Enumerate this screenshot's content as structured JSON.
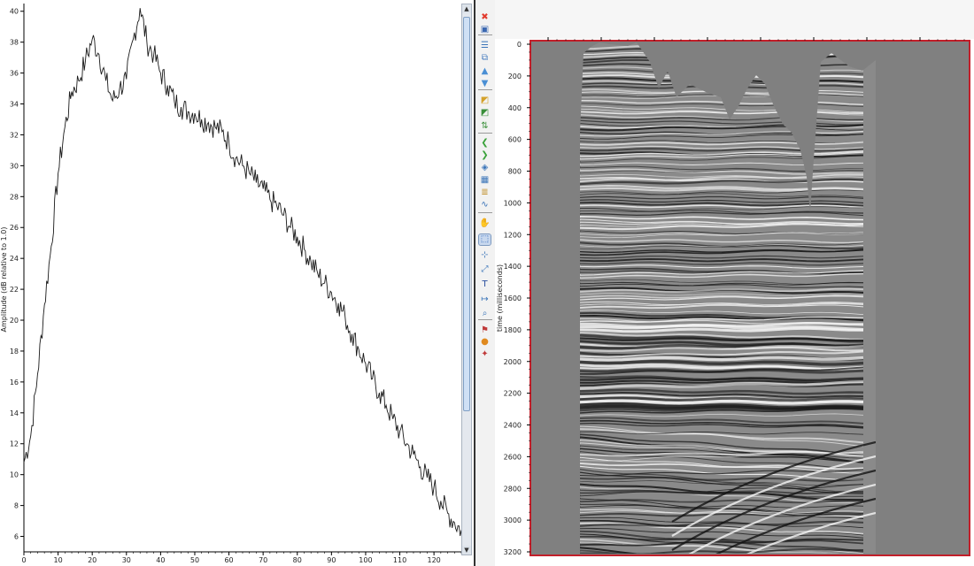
{
  "spectrum_plot": {
    "ylabel": "Amplitude (dB relative to 1.0)",
    "chart_data": {
      "type": "line",
      "xlabel": "",
      "ylabel": "Amplitude (dB relative to 1.0)",
      "xlim": [
        0,
        128
      ],
      "ylim": [
        5,
        40.5
      ],
      "x_ticks": [
        0,
        10,
        20,
        30,
        40,
        50,
        60,
        70,
        80,
        90,
        100,
        110,
        120
      ],
      "y_ticks": [
        6,
        8,
        10,
        12,
        14,
        16,
        18,
        20,
        22,
        24,
        26,
        28,
        30,
        32,
        34,
        36,
        38,
        40
      ],
      "series": [
        {
          "x": [
            0,
            2,
            4,
            6,
            8,
            10,
            12,
            14,
            16,
            18,
            20,
            22,
            24,
            26,
            28,
            30,
            32,
            34,
            36,
            38,
            40,
            42,
            44,
            46,
            48,
            50,
            52,
            54,
            56,
            58,
            60,
            62,
            64,
            66,
            68,
            70,
            72,
            74,
            76,
            78,
            80,
            82,
            84,
            86,
            88,
            90,
            92,
            94,
            96,
            98,
            100,
            102,
            104,
            106,
            108,
            110,
            112,
            114,
            116,
            118,
            120,
            122,
            124,
            126,
            128
          ],
          "values": [
            10.8,
            12.5,
            16.5,
            21,
            24.8,
            29.5,
            32.5,
            34.8,
            35.5,
            36.8,
            38.2,
            37.2,
            35.5,
            34.2,
            35,
            35.6,
            38.2,
            40.2,
            38,
            37.2,
            36,
            35.2,
            34.2,
            33.8,
            33.5,
            33.4,
            33,
            32.8,
            32.5,
            32.2,
            31.5,
            30.5,
            30,
            29.5,
            28.9,
            28.5,
            27.8,
            27.4,
            26.8,
            26,
            25.4,
            24.6,
            23.8,
            23,
            22.4,
            21.8,
            21.1,
            20.2,
            19.1,
            18.1,
            17.2,
            16.2,
            15.3,
            14.5,
            13.6,
            12.8,
            12,
            11.3,
            10.5,
            9.8,
            9.2,
            8.3,
            7.5,
            6.9,
            6.4
          ]
        }
      ]
    }
  },
  "toolbar": {
    "tools": [
      {
        "name": "close-tool-icon",
        "glyph": "✖",
        "color": "#e23b2e"
      },
      {
        "name": "print-tool-icon",
        "glyph": "▣",
        "color": "#3a67b0"
      },
      {
        "name": "list-tool-icon",
        "glyph": "☰",
        "color": "#3a74b8"
      },
      {
        "name": "copy-tool-icon",
        "glyph": "⧉",
        "color": "#4a7fc0"
      },
      {
        "name": "arrow-up-tool-icon",
        "glyph": "▲",
        "color": "#4a8fd4"
      },
      {
        "name": "arrow-down-tool-icon",
        "glyph": "▼",
        "color": "#4a8fd4"
      },
      {
        "name": "page-edit-tool-icon",
        "glyph": "◩",
        "color": "#d4a12a"
      },
      {
        "name": "page-check-tool-icon",
        "glyph": "◩",
        "color": "#3a8f3a"
      },
      {
        "name": "exchange-tool-icon",
        "glyph": "⇅",
        "color": "#3a8f3a"
      },
      {
        "name": "previous-tool-icon",
        "glyph": "❮",
        "color": "#3aa23a"
      },
      {
        "name": "next-tool-icon",
        "glyph": "❯",
        "color": "#3aa23a"
      },
      {
        "name": "layers-tool-icon",
        "glyph": "◈",
        "color": "#3a74b8"
      },
      {
        "name": "image-tool-icon",
        "glyph": "▦",
        "color": "#3a74b8"
      },
      {
        "name": "stack-tool-icon",
        "glyph": "≣",
        "color": "#c0902a"
      },
      {
        "name": "wave-tool-icon",
        "glyph": "∿",
        "color": "#3a74b8"
      },
      {
        "name": "hand-pan-tool-icon",
        "glyph": "✋",
        "color": "#777777"
      },
      {
        "name": "zoom-box-tool-icon",
        "glyph": "⬚",
        "color": "#2a62b8"
      },
      {
        "name": "pick-tool-icon",
        "glyph": "⊹",
        "color": "#3a74b8"
      },
      {
        "name": "expand-tool-icon",
        "glyph": "⤢",
        "color": "#3a74b8"
      },
      {
        "name": "text-tool-icon",
        "glyph": "T",
        "color": "#2a4f9e"
      },
      {
        "name": "measure-tool-icon",
        "glyph": "↦",
        "color": "#3a74b8"
      },
      {
        "name": "zoom-tool-icon",
        "glyph": "⌕",
        "color": "#3a74b8"
      },
      {
        "name": "flag-tool-icon",
        "glyph": "⚑",
        "color": "#c03a3a"
      },
      {
        "name": "color-tool-icon",
        "glyph": "●",
        "color": "#e08a20"
      },
      {
        "name": "settings-tool-icon",
        "glyph": "✦",
        "color": "#c03a3a"
      }
    ]
  },
  "seismic_view": {
    "ylabel": "time (milliseconds)",
    "y_ticks": [
      "0",
      "200",
      "400",
      "600",
      "800",
      "1000",
      "1200",
      "1400",
      "1600",
      "1800",
      "2000",
      "2200",
      "2400",
      "2600",
      "2800",
      "3000",
      "3200"
    ],
    "frame_color": "#c21f2a",
    "background_color": "#808080"
  }
}
